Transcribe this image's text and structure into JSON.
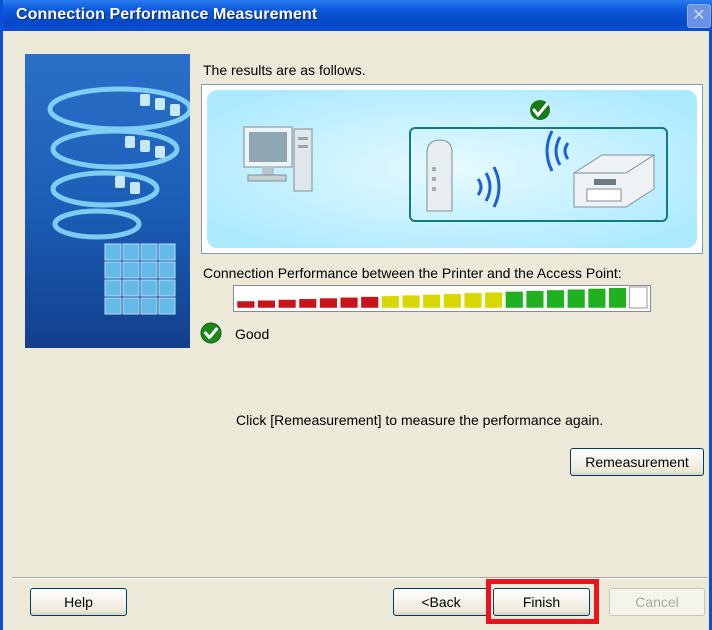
{
  "window": {
    "title": "Connection Performance Measurement",
    "close_label": "✕"
  },
  "main": {
    "results_title": "The results are as follows.",
    "perf_label": "Connection Performance between the Printer and the Access Point:",
    "meter": {
      "total_segments": 20,
      "filled_segments": 19,
      "colors": {
        "low": "#c8141a",
        "mid": "#d8d800",
        "high": "#1fb11f"
      }
    },
    "status": "Good",
    "hint": "Click [Remeasurement] to measure the performance again."
  },
  "buttons": {
    "remeasurement": "Remeasurement",
    "help": "Help",
    "back": "<Back",
    "finish": "Finish",
    "cancel": "Cancel"
  },
  "colors": {
    "titlebar": "#0a4fd8",
    "dialog_bg": "#ece9d8",
    "highlight": "#e8141e",
    "check_green": "#1a8a1a"
  }
}
